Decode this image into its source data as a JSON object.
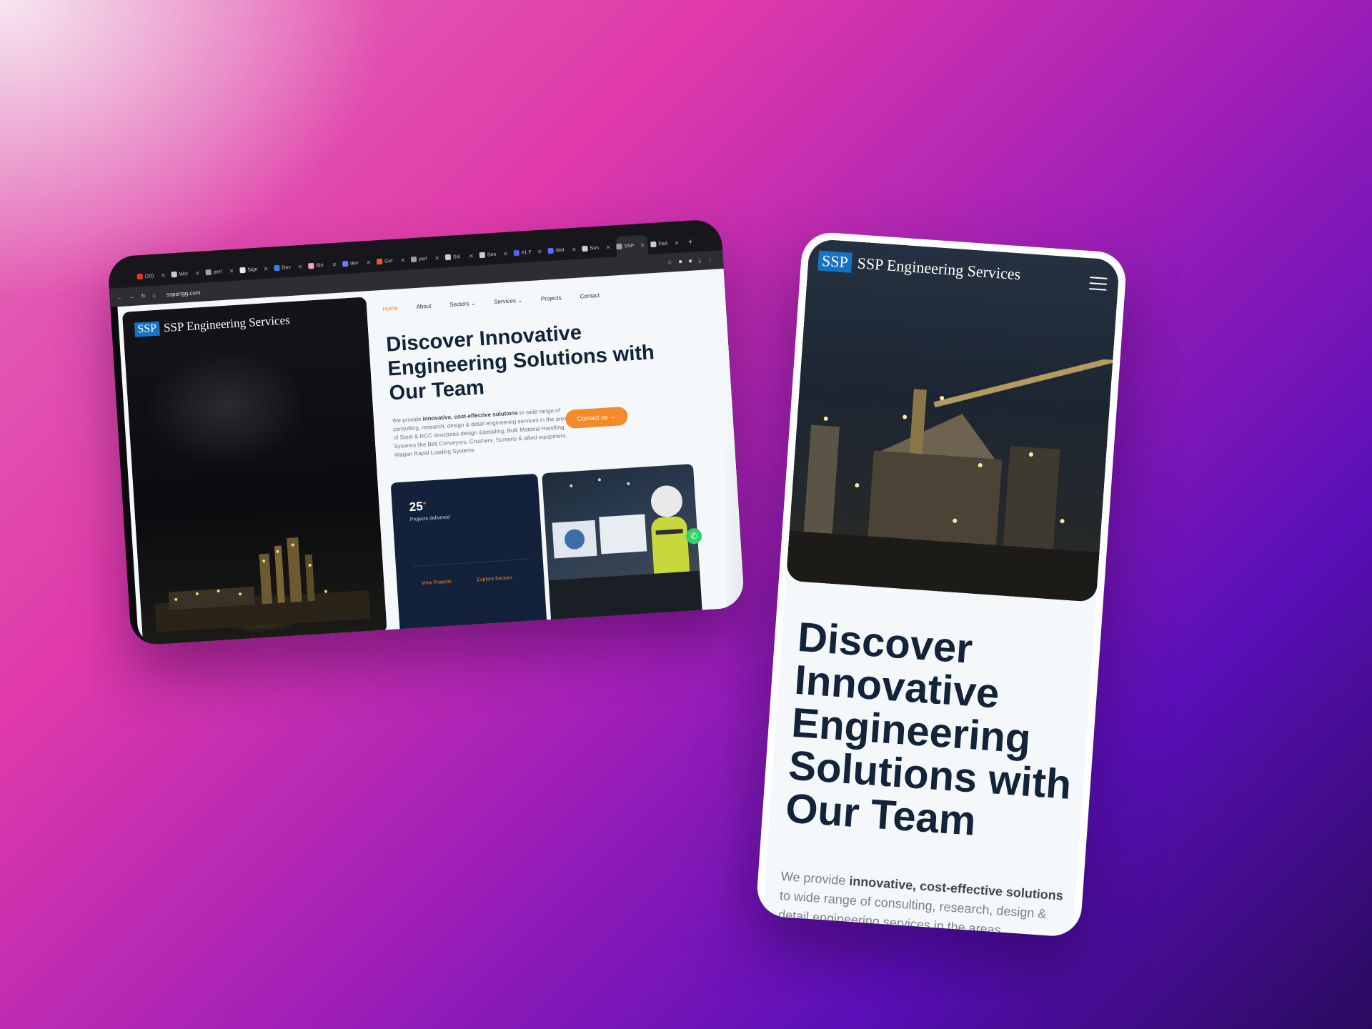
{
  "browser": {
    "tabs": [
      {
        "label": "(10)",
        "color": "#e2362d"
      },
      {
        "label": "Wor",
        "color": "#cccccc"
      },
      {
        "label": "perl",
        "color": "#9aa0a6"
      },
      {
        "label": "Sign",
        "color": "#e8e8e8"
      },
      {
        "label": "Dev",
        "color": "#3b82f6"
      },
      {
        "label": "Shi",
        "color": "#f4a7c3"
      },
      {
        "label": "dev",
        "color": "#6b7bf0"
      },
      {
        "label": "Gol",
        "color": "#e25b3a"
      },
      {
        "label": "perl",
        "color": "#9aa0a6"
      },
      {
        "label": "Sol",
        "color": "#cccccc"
      },
      {
        "label": "Son",
        "color": "#cccccc"
      },
      {
        "label": "#1 F",
        "color": "#4a66e8"
      },
      {
        "label": "Wel",
        "color": "#5b6ef0"
      },
      {
        "label": "Son",
        "color": "#cccccc"
      },
      {
        "label": "SSP",
        "color": "#9aa0a6"
      },
      {
        "label": "Pad",
        "color": "#cccccc"
      }
    ],
    "new_tab": "+",
    "url": "sspengg.com"
  },
  "site": {
    "logo_mark": "SSP",
    "logo_name": "SSP Engineering Services",
    "nav": {
      "home": "Home",
      "about": "About",
      "sectors": "Sectors",
      "services": "Services",
      "projects": "Projects",
      "contact": "Contact"
    },
    "headline": "Discover Innovative Engineering Solutions with Our Team",
    "intro_prefix": "We provide ",
    "intro_bold": "innovative, cost-effective solutions",
    "intro_rest": " to wide range of consulting, research, design & detail engineering services in the areas of Steel & RCC structures design &detailing, Bulk Material Handling Systems like Belt Conveyors, Crushers, Screens & allied equipment, Wagon Rapid Loading Systems",
    "cta": "Contact us",
    "stat_value": "25",
    "stat_suffix": "+",
    "stat_label": "Projects delivered",
    "link_projects": "View Projects",
    "link_sectors": "Explore Sectors"
  },
  "mobile": {
    "intro_rest": " to wide range of consulting, research, design & detail engineering services in the areas"
  },
  "colors": {
    "accent": "#f48a2a",
    "navy": "#13233a",
    "logo_blue": "#1572c4",
    "whatsapp": "#2bd36a"
  }
}
